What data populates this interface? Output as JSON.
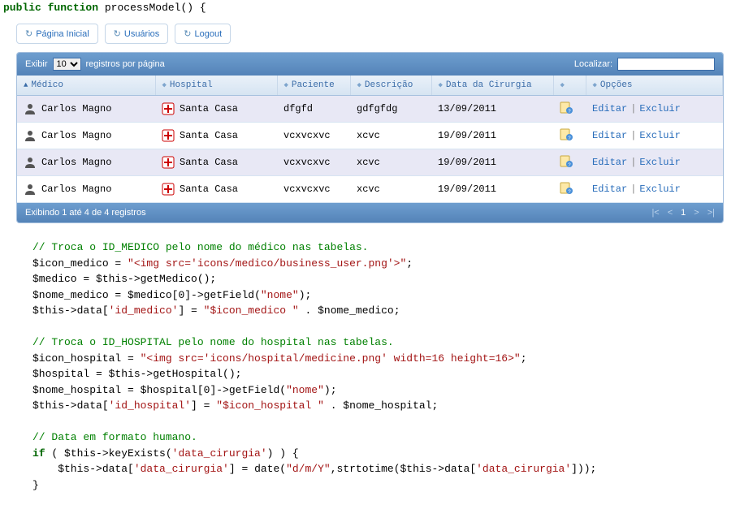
{
  "code_header": {
    "public": "public",
    "function": "function",
    "name": "processModel",
    "paren": "() {"
  },
  "toolbar": {
    "home": "Página Inicial",
    "users": "Usuários",
    "logout": "Logout"
  },
  "datatable": {
    "show_label": "Exibir",
    "per_page_label": "registros por página",
    "page_size": "10",
    "search_label": "Localizar:",
    "columns": {
      "medico": "Médico",
      "hospital": "Hospital",
      "paciente": "Paciente",
      "descricao": "Descrição",
      "data": "Data da Cirurgia",
      "opcoes": "Opções"
    },
    "rows": [
      {
        "medico": "Carlos Magno",
        "hospital": "Santa Casa",
        "paciente": "dfgfd",
        "descricao": "gdfgfdg",
        "data": "13/09/2011"
      },
      {
        "medico": "Carlos Magno",
        "hospital": "Santa Casa",
        "paciente": "vcxvcxvc",
        "descricao": "xcvc",
        "data": "19/09/2011"
      },
      {
        "medico": "Carlos Magno",
        "hospital": "Santa Casa",
        "paciente": "vcxvcxvc",
        "descricao": "xcvc",
        "data": "19/09/2011"
      },
      {
        "medico": "Carlos Magno",
        "hospital": "Santa Casa",
        "paciente": "vcxvcxvc",
        "descricao": "xcvc",
        "data": "19/09/2011"
      }
    ],
    "actions": {
      "edit": "Editar",
      "delete": "Excluir"
    },
    "info": "Exibindo 1 até 4 de 4 registros",
    "pager": {
      "first": "|<",
      "prev": "<",
      "page": "1",
      "next": ">",
      "last": ">|"
    }
  },
  "code_body": {
    "c1": "// Troca o ID_MEDICO pelo nome do médico nas tabelas.",
    "l2a": "$icon_medico = ",
    "l2b": "\"<img src='icons/medico/business_user.png'>\"",
    "l2c": ";",
    "l3": "$medico = $this->getMedico();",
    "l4a": "$nome_medico = $medico[",
    "l4b": "0",
    "l4c": "]->getField(",
    "l4d": "\"nome\"",
    "l4e": ");",
    "l5a": "$this->data[",
    "l5b": "'id_medico'",
    "l5c": "] = ",
    "l5d": "\"$icon_medico \"",
    "l5e": " . $nome_medico;",
    "c2": "// Troca o ID_HOSPITAL pelo nome do hospital nas tabelas.",
    "l7a": "$icon_hospital = ",
    "l7b": "\"<img src='icons/hospital/medicine.png' width=16 height=16>\"",
    "l7c": ";",
    "l8": "$hospital = $this->getHospital();",
    "l9a": "$nome_hospital = $hospital[",
    "l9b": "0",
    "l9c": "]->getField(",
    "l9d": "\"nome\"",
    "l9e": ");",
    "l10a": "$this->data[",
    "l10b": "'id_hospital'",
    "l10c": "] = ",
    "l10d": "\"$icon_hospital \"",
    "l10e": " . $nome_hospital;",
    "c3": "// Data em formato humano.",
    "l12a": "if",
    "l12b": " ( $this->keyExists(",
    "l12c": "'data_cirurgia'",
    "l12d": ") ) {",
    "l13a": "    $this->data[",
    "l13b": "'data_cirurgia'",
    "l13c": "] = date(",
    "l13d": "\"d/m/Y\"",
    "l13e": ",strtotime($this->data[",
    "l13f": "'data_cirurgia'",
    "l13g": "]));",
    "l14": "}"
  }
}
